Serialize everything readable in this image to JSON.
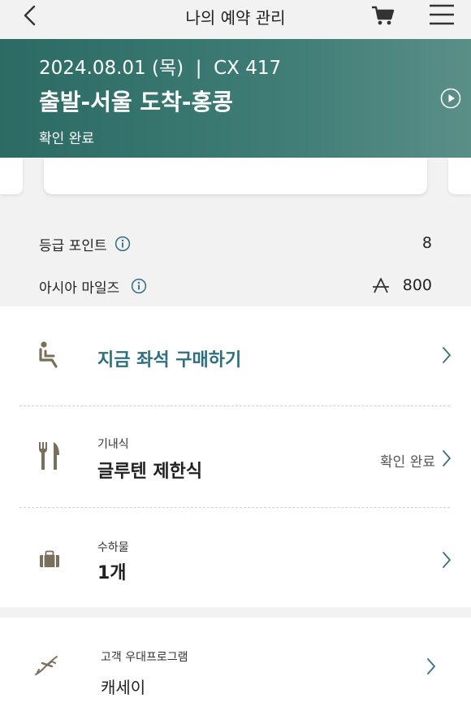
{
  "header": {
    "title": "나의 예약 관리"
  },
  "flight": {
    "summary": "2024.08.01 (목)  |  CX 417",
    "route": "출발-서울 도착-홍콩",
    "status": "확인 완료"
  },
  "points": {
    "tier_label": "등급 포인트",
    "tier_value": "8",
    "miles_label": "아시아 마일즈",
    "miles_value": "800"
  },
  "services": {
    "seat": {
      "label": "지금 좌석 구매하기"
    },
    "meal": {
      "category": "기내식",
      "value": "글루텐 제한식",
      "status": "확인 완료"
    },
    "baggage": {
      "category": "수하물",
      "value": "1개"
    },
    "loyalty": {
      "category": "고객 우대프로그램",
      "value": "캐세이"
    }
  },
  "colors": {
    "banner": "#2b6b64",
    "accent_text": "#2d6f80",
    "icon_tan": "#7a6f5c"
  }
}
